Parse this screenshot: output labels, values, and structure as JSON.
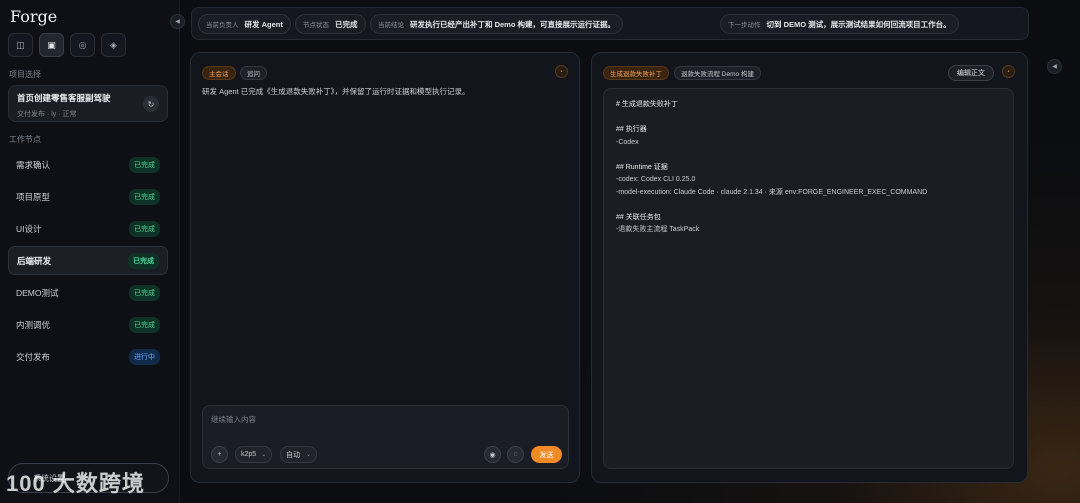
{
  "app": {
    "title": "Forge"
  },
  "toolbar_icons": [
    {
      "name": "panel-icon",
      "glyph": "◫"
    },
    {
      "name": "square-icon",
      "glyph": "▣"
    },
    {
      "name": "circle-icon",
      "glyph": "◎"
    },
    {
      "name": "diamond-icon",
      "glyph": "◈"
    }
  ],
  "sidebar": {
    "project_section_label": "项目选择",
    "project": {
      "name": "首页创建零售客服副驾驶",
      "sub": "交付发布 · ly · 正常",
      "action_glyph": "↻"
    },
    "nodes_section_label": "工作节点",
    "nodes": [
      {
        "label": "需求确认",
        "status": "已完成"
      },
      {
        "label": "项目原型",
        "status": "已完成"
      },
      {
        "label": "UI设计",
        "status": "已完成"
      },
      {
        "label": "后端研发",
        "status": "已完成"
      },
      {
        "label": "DEMO测试",
        "status": "已完成"
      },
      {
        "label": "内测调优",
        "status": "已完成"
      },
      {
        "label": "交付发布",
        "status": "进行中"
      }
    ],
    "settings_label": "系统设置",
    "watermark": "100 大数跨境"
  },
  "topbar": {
    "owner": {
      "key": "当前负责人",
      "value": "研发 Agent"
    },
    "node_status": {
      "key": "节点状态",
      "value": "已完成"
    },
    "conclusion": {
      "key": "当前结论",
      "value": "研发执行已经产出补丁和 Demo 构建，可直接展示运行证据。"
    },
    "next_action": {
      "key": "下一步动作",
      "value": "切到 DEMO 测试，展示测试结果如何回流项目工作台。"
    }
  },
  "left_panel": {
    "tags": [
      "主会话",
      "追问"
    ],
    "message": "研发 Agent 已完成《生成退款失败补丁》，并保留了运行时证据和模型执行记录。",
    "composer": {
      "placeholder": "继续输入内容",
      "add_glyph": "+",
      "model": "k2p5",
      "mode": "自动",
      "send_label": "发送"
    }
  },
  "right_panel": {
    "tags": [
      "生成退款失败补丁",
      "退款失败流程 Demo 构建"
    ],
    "edit_label": "编辑正文",
    "doc": [
      "# 生成退款失败补丁",
      "",
      "## 执行器",
      "-Codex",
      "",
      "## Runtime 证据",
      "-codex: Codex CLI 0.25.0",
      "-model-execution: Claude Code · claude 2.1.34 · 来源 env:FORGE_ENGINEER_EXEC_COMMAND",
      "",
      "## 关联任务包",
      "-退款失败主流程 TaskPack"
    ]
  }
}
